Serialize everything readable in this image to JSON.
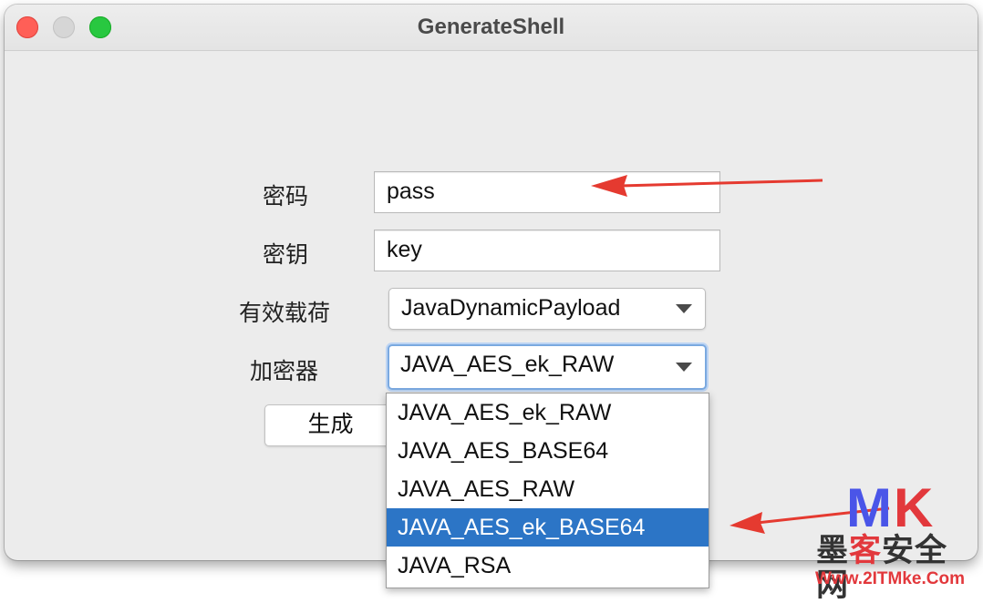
{
  "window": {
    "title": "GenerateShell"
  },
  "form": {
    "password_label": "密码",
    "password_value": "pass",
    "key_label": "密钥",
    "key_value": "key",
    "payload_label": "有效载荷",
    "payload_selected": "JavaDynamicPayload",
    "encryptor_label": "加密器",
    "encryptor_selected": "JAVA_AES_ek_RAW",
    "generate_label": "生成"
  },
  "dropdown": {
    "options": [
      "JAVA_AES_ek_RAW",
      "JAVA_AES_BASE64",
      "JAVA_AES_RAW",
      "JAVA_AES_ek_BASE64",
      "JAVA_RSA"
    ],
    "highlighted_index": 3
  },
  "watermark": {
    "logo_m": "M",
    "logo_k": "K",
    "site_name_1": "墨",
    "site_name_2": "客",
    "site_name_3": "安全网",
    "url": "Www.2ITMke.Com"
  },
  "colors": {
    "highlight": "#2c75c6",
    "annotation_arrow": "#e53a30",
    "close": "#ff5f57",
    "maximize": "#28c840"
  },
  "icons": {
    "dropdown_caret": "chevron-down-icon"
  }
}
